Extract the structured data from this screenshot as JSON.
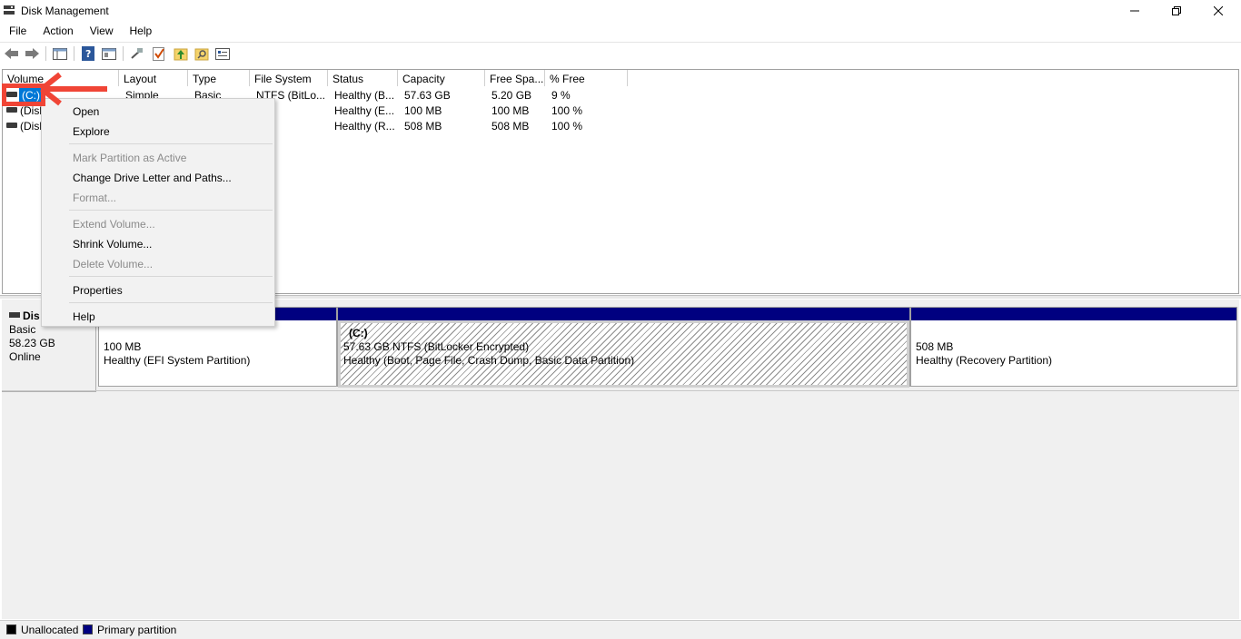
{
  "window": {
    "title": "Disk Management"
  },
  "menu": [
    "File",
    "Action",
    "View",
    "Help"
  ],
  "toolbar_icons": [
    "back-arrow-icon",
    "forward-arrow-icon",
    "console-tree-icon",
    "help-icon",
    "properties-icon",
    "connect-icon",
    "check-icon",
    "folder-up-icon",
    "search-folder-icon",
    "settings-list-icon"
  ],
  "volume_table": {
    "columns": [
      "Volume",
      "Layout",
      "Type",
      "File System",
      "Status",
      "Capacity",
      "Free Spa...",
      "% Free"
    ],
    "rows": [
      {
        "volume": "(C:)",
        "layout": "Simple",
        "type": "Basic",
        "fs": "NTFS (BitLo...",
        "status": "Healthy (B...",
        "capacity": "57.63 GB",
        "free": "5.20 GB",
        "pct": "9 %"
      },
      {
        "volume": "(Disk",
        "layout": "",
        "type": "",
        "fs": "",
        "status": "Healthy (E...",
        "capacity": "100 MB",
        "free": "100 MB",
        "pct": "100 %"
      },
      {
        "volume": "(Disk",
        "layout": "",
        "type": "",
        "fs": "",
        "status": "Healthy (R...",
        "capacity": "508 MB",
        "free": "508 MB",
        "pct": "100 %"
      }
    ]
  },
  "disk": {
    "name": "Dis",
    "type": "Basic",
    "size": "58.23 GB",
    "state": "Online"
  },
  "partitions": [
    {
      "name": "",
      "size": "100 MB",
      "status": "Healthy (EFI System Partition)"
    },
    {
      "name": "(C:)",
      "size": "57.63 GB NTFS (BitLocker Encrypted)",
      "status": "Healthy (Boot, Page File, Crash Dump, Basic Data Partition)"
    },
    {
      "name": "",
      "size": "508 MB",
      "status": "Healthy (Recovery Partition)"
    }
  ],
  "legend": {
    "unallocated": "Unallocated",
    "primary": "Primary partition",
    "unallocated_color": "#000000",
    "primary_color": "#000080"
  },
  "context_menu": {
    "open": "Open",
    "explore": "Explore",
    "mark_active": "Mark Partition as Active",
    "change_letter": "Change Drive Letter and Paths...",
    "format": "Format...",
    "extend": "Extend Volume...",
    "shrink": "Shrink Volume...",
    "delete": "Delete Volume...",
    "properties": "Properties",
    "help": "Help"
  },
  "colors": {
    "selection": "#0078d7",
    "partition_bar": "#000080",
    "annotation": "#f04536"
  }
}
